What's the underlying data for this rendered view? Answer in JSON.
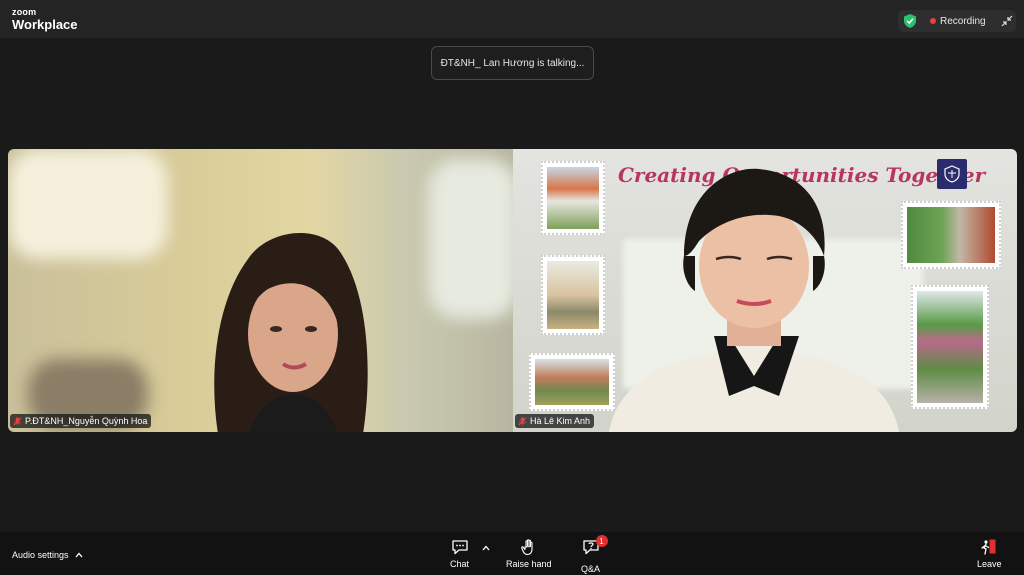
{
  "app": {
    "logo_top": "zoom",
    "logo_bottom": "Workplace"
  },
  "recording": {
    "label": "Recording",
    "dot_color": "#e84141",
    "shield_color": "#2fbf71"
  },
  "talking_indicator": "ĐT&NH_ Lan Hương is talking...",
  "participants": [
    {
      "name": "P.ĐT&NH_Nguyễn Quỳnh Hoa",
      "muted": true
    },
    {
      "name": "Hà Lê Kim Anh",
      "muted": true
    }
  ],
  "background_banner": "Creating Opportunities Together",
  "toolbar": {
    "audio_settings": "Audio settings",
    "chat": "Chat",
    "raise_hand": "Raise hand",
    "qa": "Q&A",
    "qa_count": "1",
    "leave": "Leave"
  },
  "colors": {
    "leave": "#e02f2f",
    "badge": "#e02f2f",
    "banner": "#b7365f"
  }
}
